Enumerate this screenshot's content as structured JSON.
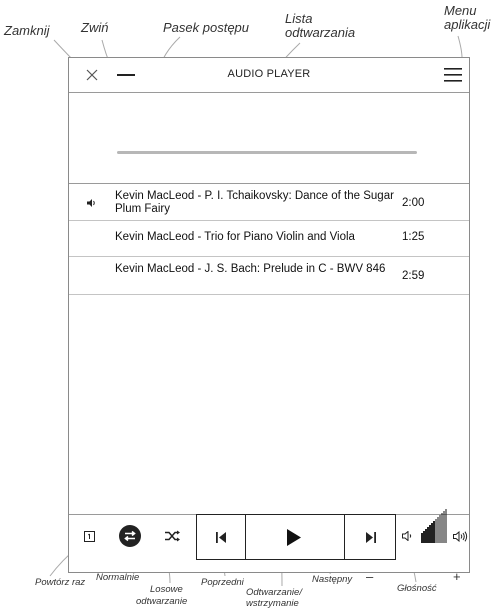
{
  "annotations": {
    "close": "Zamknij",
    "minimize": "Zwiń",
    "progress": "Pasek postępu",
    "playlist_line1": "Lista",
    "playlist_line2": "odtwarzania",
    "menu_line1": "Menu",
    "menu_line2": "aplikacji",
    "repeat_once": "Powtórz raz",
    "normal": "Normalnie",
    "shuffle_line1": "Losowe",
    "shuffle_line2": "odtwarzanie",
    "previous": "Poprzedni",
    "playpause_line1": "Odtwarzanie/",
    "playpause_line2": "wstrzymanie",
    "next": "Następny",
    "volume_minus": "–",
    "volume": "Głośność",
    "volume_plus": "+"
  },
  "header": {
    "title": "AUDIO PLAYER",
    "close_icon": "close-icon",
    "minimize_icon": "minimize-icon",
    "menu_icon": "hamburger-menu-icon"
  },
  "progress": {
    "value": 0
  },
  "playlist": [
    {
      "title": "Kevin MacLeod - P. I. Tchaikovsky: Dance of the Sugar Plum Fairy",
      "duration": "2:00",
      "playing": true
    },
    {
      "title": "Kevin MacLeod - Trio for Piano Violin and Viola",
      "duration": "1:25",
      "playing": false
    },
    {
      "title": "Kevin MacLeod - J. S. Bach: Prelude in C - BWV 846",
      "duration": "2:59",
      "playing": false
    }
  ],
  "controls": {
    "repeat_once_icon": "repeat-once-icon",
    "normal_icon": "normal-mode-icon",
    "shuffle_icon": "shuffle-icon",
    "previous_icon": "previous-icon",
    "play_icon": "play-icon",
    "next_icon": "next-icon",
    "volume_down_icon": "volume-down-icon",
    "volume_up_icon": "volume-up-icon",
    "volume_level": 0.2
  },
  "colors": {
    "border": "#9a9a9a",
    "text": "#222222",
    "progress_track": "#b7b7b7"
  }
}
